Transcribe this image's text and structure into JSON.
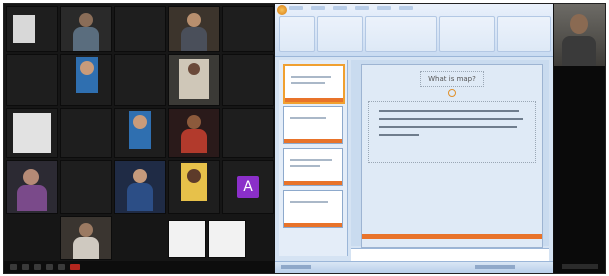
{
  "gallery": {
    "tiles": [
      {
        "label": ""
      },
      {
        "label": ""
      },
      {
        "label": ""
      },
      {
        "label": ""
      },
      {
        "label": ""
      },
      {
        "label": ""
      },
      {
        "label": ""
      },
      {
        "label": ""
      },
      {
        "label": ""
      },
      {
        "label": ""
      },
      {
        "label": ""
      },
      {
        "label": ""
      },
      {
        "label": ""
      },
      {
        "label": ""
      },
      {
        "label": ""
      },
      {
        "label": ""
      },
      {
        "label": ""
      },
      {
        "label": ""
      },
      {
        "label": ""
      },
      {
        "label": ""
      }
    ],
    "avatar_initial": "A",
    "avatar_color": "#8b2fc9",
    "leave_button_color": "#b3261e"
  },
  "presentation": {
    "slide_title": "What is map?",
    "accent_color": "#e8732a"
  },
  "icons": [
    "office-button-icon",
    "mic-icon",
    "camera-icon",
    "share-screen-icon",
    "participants-icon",
    "chat-icon",
    "leave-call-icon"
  ]
}
